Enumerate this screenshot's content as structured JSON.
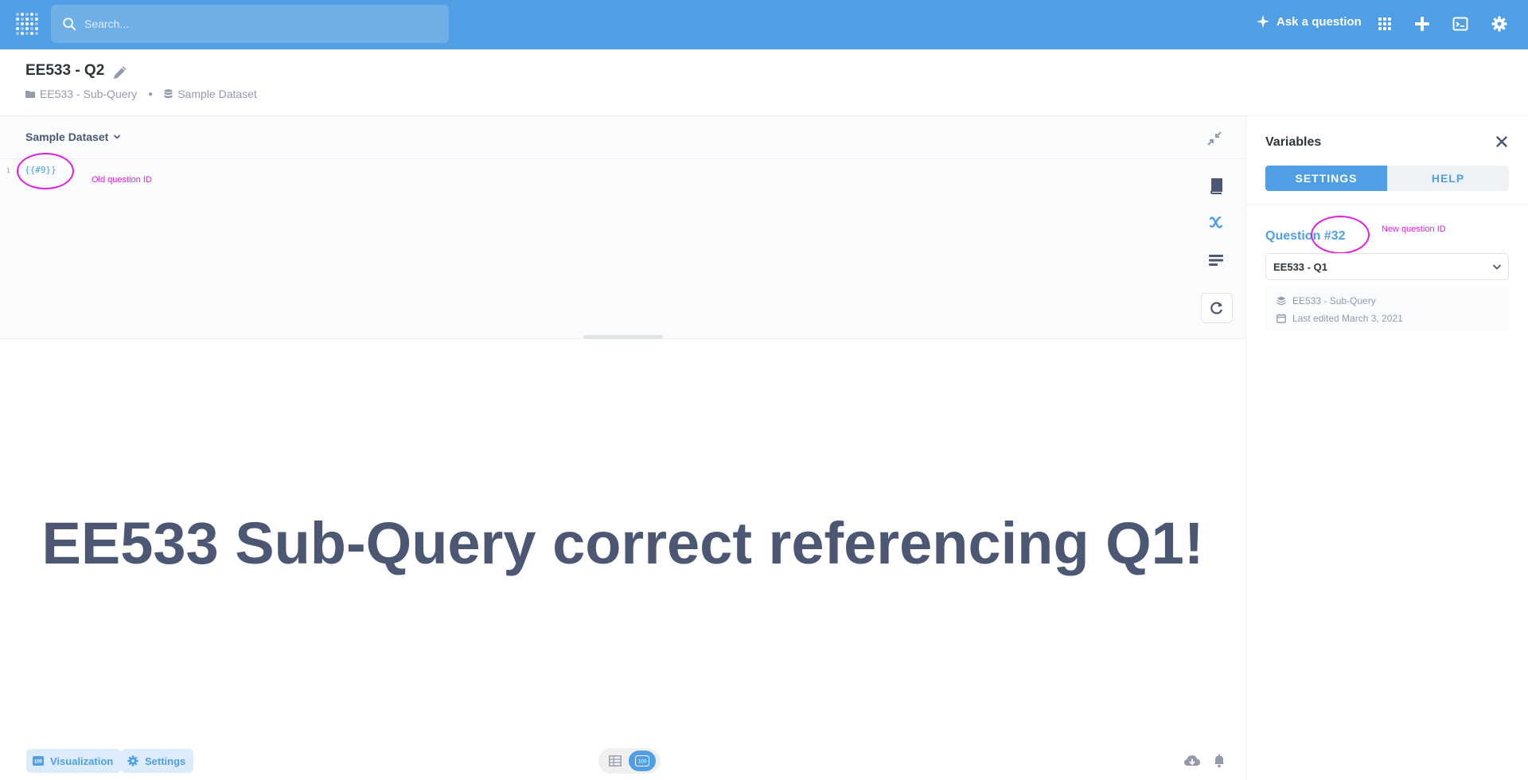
{
  "nav": {
    "search_placeholder": "Search...",
    "ask_label": "Ask a question",
    "brand_color": "#509ee3"
  },
  "header": {
    "title": "EE533 - Q2",
    "collection": "EE533 - Sub-Query",
    "database": "Sample Dataset"
  },
  "editor": {
    "database_select": "Sample Dataset",
    "line_number": "1",
    "code": "{{#9}}",
    "annotation": "Old question ID"
  },
  "result": {
    "text": "EE533 Sub-Query correct referencing Q1!"
  },
  "footer": {
    "visualization_label": "Visualization",
    "settings_label": "Settings",
    "row_toggle_badge": "100"
  },
  "sidebar": {
    "title": "Variables",
    "tab_settings": "SETTINGS",
    "tab_help": "HELP",
    "question_label": "Question #32",
    "annotation": "New question ID",
    "selected_question": "EE533 - Q1",
    "meta_collection": "EE533 - Sub-Query",
    "meta_edited": "Last edited March 3, 2021"
  }
}
